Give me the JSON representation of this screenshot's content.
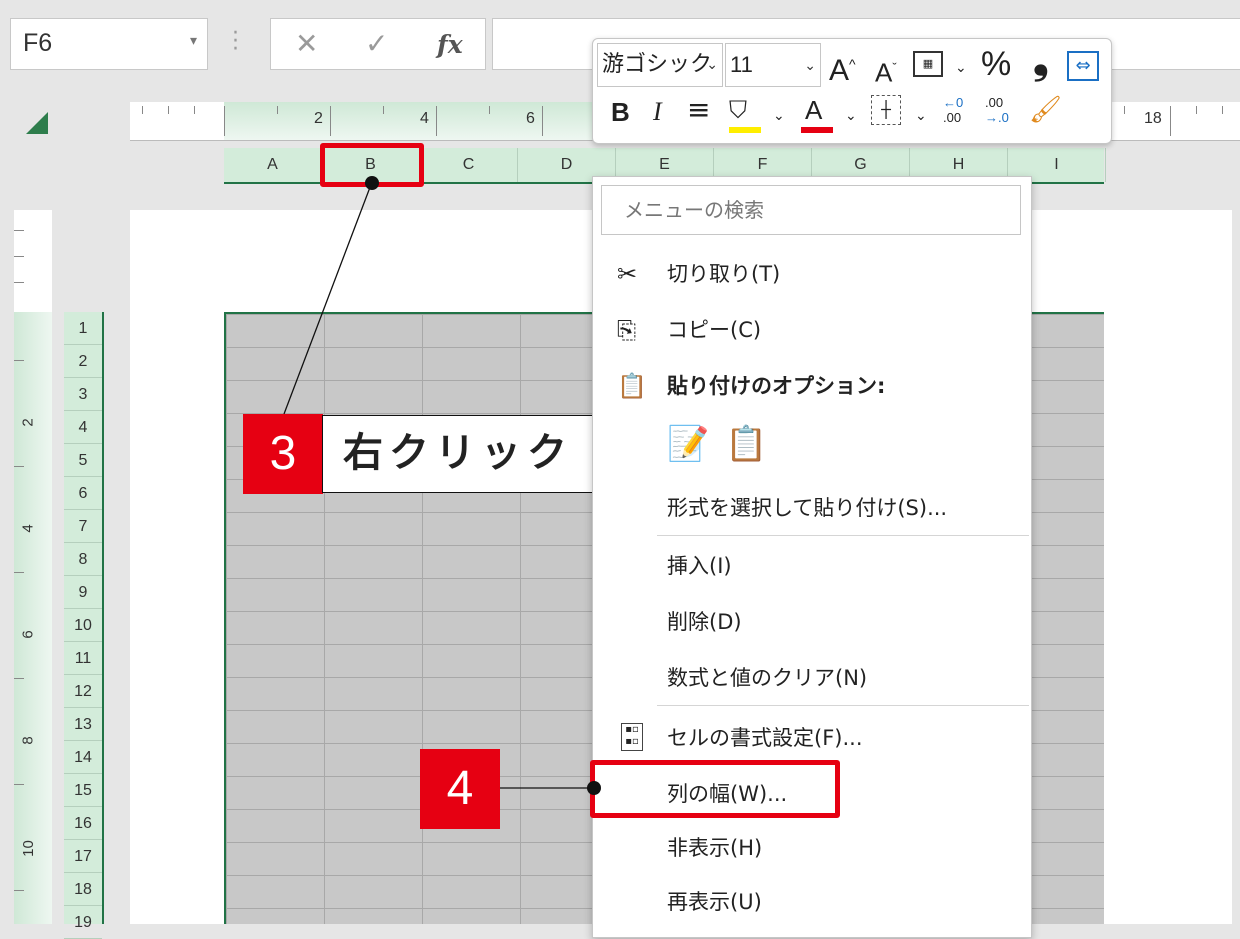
{
  "formula_bar": {
    "name_box": "F6",
    "fx": "fx",
    "cancel": "✕",
    "enter": "✓"
  },
  "ruler": {
    "labels": [
      "2",
      "4",
      "6",
      "18"
    ]
  },
  "vruler": {
    "labels": [
      "2",
      "4",
      "6",
      "8",
      "10"
    ]
  },
  "columns": [
    "A",
    "B",
    "C",
    "D",
    "E",
    "F",
    "G",
    "H",
    "I"
  ],
  "rows": [
    "1",
    "2",
    "3",
    "4",
    "5",
    "6",
    "7",
    "8",
    "9",
    "10",
    "11",
    "12",
    "13",
    "14",
    "15",
    "16",
    "17",
    "18",
    "19"
  ],
  "mini_toolbar": {
    "font_name": "游ゴシック",
    "font_size": "11",
    "increase_font": "A",
    "decrease_font": "A",
    "percent": "%",
    "comma": "❟",
    "bold": "B",
    "italic": "I",
    "font_color_letter": "A",
    "inc_decimal_top": "←0",
    "inc_decimal_bottom": ".00",
    "dec_decimal_top": ".00",
    "dec_decimal_bottom": "→.0"
  },
  "context_menu": {
    "search_placeholder": "メニューの検索",
    "cut": "切り取り(T)",
    "copy": "コピー(C)",
    "paste_options": "貼り付けのオプション:",
    "paste_special": "形式を選択して貼り付け(S)...",
    "insert": "挿入(I)",
    "delete": "削除(D)",
    "clear": "数式と値のクリア(N)",
    "format_cells": "セルの書式設定(F)...",
    "column_width": "列の幅(W)...",
    "hide": "非表示(H)",
    "unhide": "再表示(U)"
  },
  "annotations": {
    "step3_num": "3",
    "step3_text": "右クリック",
    "step4_num": "4"
  },
  "colors": {
    "excel_green": "#217346",
    "callout_red": "#e60012",
    "grid_gray": "#c8c8c8"
  }
}
